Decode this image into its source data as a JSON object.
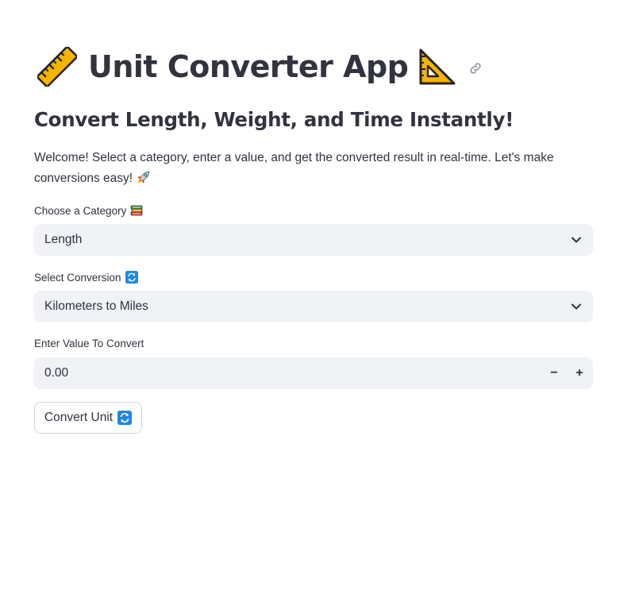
{
  "header": {
    "title": "Unit Converter App",
    "title_left_icon": "ruler-icon",
    "title_right_icon": "triangular-ruler-icon",
    "anchor_icon": "link-icon"
  },
  "subheader": "Convert Length, Weight, and Time Instantly!",
  "intro_text": "Welcome! Select a category, enter a value, and get the converted result in real-time. Let's make conversions easy!",
  "intro_icon": "rocket-icon",
  "category": {
    "label": "Choose a Category",
    "label_icon": "books-icon",
    "value": "Length"
  },
  "conversion": {
    "label": "Select Conversion",
    "label_icon": "arrows-cycle-icon",
    "value": "Kilometers to Miles"
  },
  "value_input": {
    "label": "Enter Value To Convert",
    "value": "0.00",
    "decrement_label": "−",
    "increment_label": "+"
  },
  "convert_button": {
    "label": "Convert Unit",
    "icon": "arrows-cycle-icon"
  },
  "colors": {
    "text": "#31333f",
    "input_bg": "#f0f2f6",
    "border": "#d3d5da",
    "emoji_blue": "#1e88e5",
    "emoji_yellow": "#f5b400"
  }
}
